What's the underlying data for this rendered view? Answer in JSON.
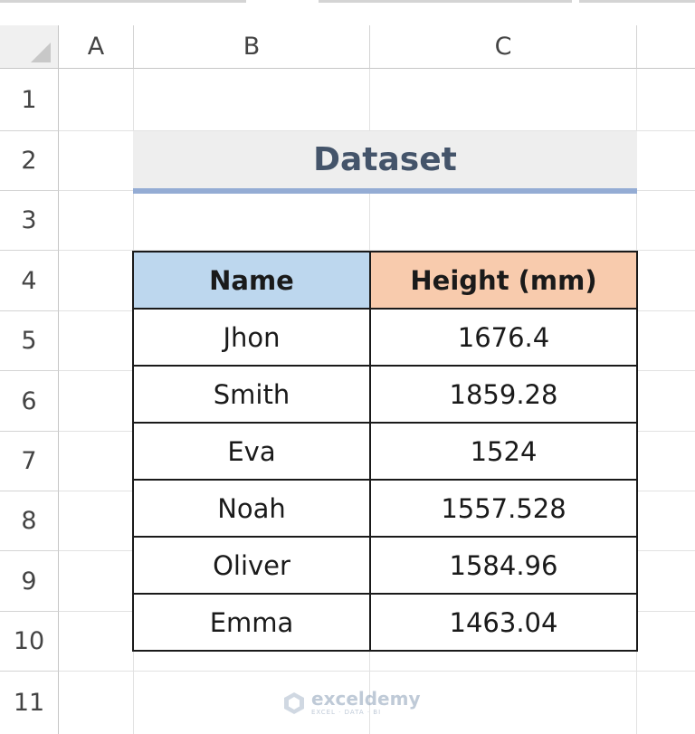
{
  "columns": [
    "A",
    "B",
    "C"
  ],
  "rows": [
    "1",
    "2",
    "3",
    "4",
    "5",
    "6",
    "7",
    "8",
    "9",
    "10",
    "11"
  ],
  "title": "Dataset",
  "table": {
    "headers": [
      "Name",
      "Height (mm)"
    ],
    "rows": [
      [
        "Jhon",
        "1676.4"
      ],
      [
        "Smith",
        "1859.28"
      ],
      [
        "Eva",
        "1524"
      ],
      [
        "Noah",
        "1557.528"
      ],
      [
        "Oliver",
        "1584.96"
      ],
      [
        "Emma",
        "1463.04"
      ]
    ]
  },
  "watermark": {
    "name": "exceldemy",
    "tagline": "EXCEL · DATA · BI"
  },
  "colors": {
    "name_header_bg": "#bdd7ee",
    "height_header_bg": "#f8cbad",
    "title_bg": "#eeeeee",
    "title_text": "#44546a",
    "title_underline": "#94acd4"
  }
}
